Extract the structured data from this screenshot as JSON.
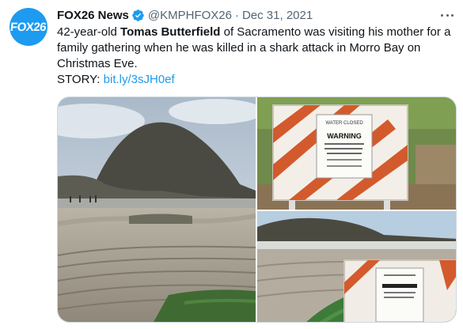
{
  "tweet": {
    "author_name": "FOX26 News",
    "avatar_text": "FOX26",
    "handle": "@KMPHFOX26",
    "separator": "·",
    "date": "Dec 31, 2021",
    "text_part1": "42-year-old ",
    "text_bold": "Tomas Butterfield",
    "text_part2": " of Sacramento was visiting his mother for a family gathering when he was killed in a shark attack in Morro Bay on Christmas Eve.",
    "story_label": "STORY: ",
    "story_link": "bit.ly/3sJH0ef"
  },
  "photos": {
    "sign_heading": "WATER CLOSED",
    "sign_warning": "WARNING"
  },
  "colors": {
    "link": "#1d9bf0",
    "verified": "#1d9bf0",
    "avatar_bg": "#1d9bf0",
    "muted": "#536471"
  },
  "icons": {
    "verified": "verified-badge-icon",
    "more": "more-options-icon"
  }
}
